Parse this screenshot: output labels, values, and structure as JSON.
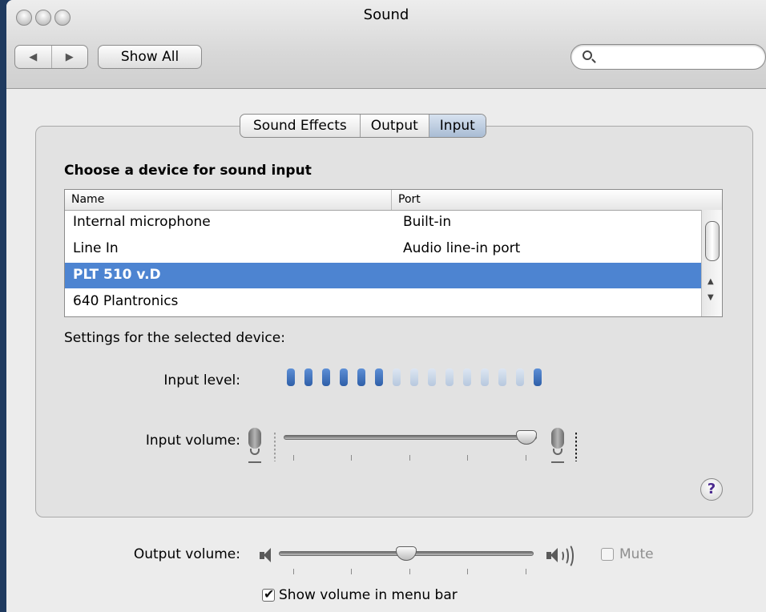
{
  "window": {
    "title": "Sound"
  },
  "toolbar": {
    "back_glyph": "◀",
    "forward_glyph": "▶",
    "show_all_label": "Show All",
    "search_placeholder": ""
  },
  "tabs": [
    {
      "label": "Sound Effects",
      "active": false
    },
    {
      "label": "Output",
      "active": false
    },
    {
      "label": "Input",
      "active": true
    }
  ],
  "input": {
    "section_title": "Choose a device for sound input",
    "columns": {
      "name": "Name",
      "port": "Port"
    },
    "devices": [
      {
        "name": "Internal microphone",
        "port": "Built-in",
        "selected": false
      },
      {
        "name": "Line In",
        "port": "Audio line-in port",
        "selected": false
      },
      {
        "name": "PLT 510 v.D",
        "port": "",
        "selected": true
      },
      {
        "name": "640 Plantronics",
        "port": "",
        "selected": false
      }
    ],
    "settings_label": "Settings for the selected device:",
    "input_level_label": "Input level:",
    "input_level": {
      "segments_total": 15,
      "segments_lit": 6,
      "peak_segment": 15
    },
    "input_volume_label": "Input volume:",
    "input_volume_fraction": 1.0
  },
  "help": {
    "glyph": "?"
  },
  "output": {
    "output_volume_label": "Output volume:",
    "output_volume_fraction": 0.5,
    "mute_label": "Mute",
    "mute_checked": false,
    "show_volume_label": "Show volume in menu bar",
    "show_volume_checked": true
  },
  "colors": {
    "selection": "#4d84d1",
    "level_on": "#2f5fa8",
    "level_off": "#b7c8de",
    "help_glyph": "#4b2a8f"
  }
}
